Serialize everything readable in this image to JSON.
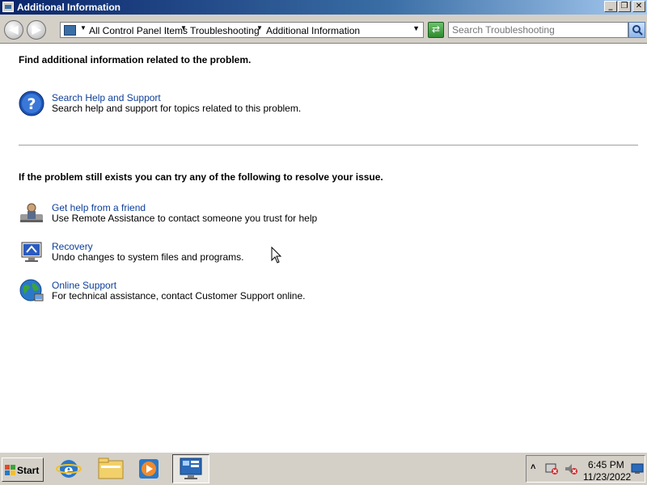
{
  "window": {
    "title": "Additional Information",
    "controls": {
      "minimize": "_",
      "maximize": "❐",
      "close": "✕"
    }
  },
  "toolbar": {
    "breadcrumb": [
      "All Control Panel Items",
      "Troubleshooting",
      "Additional Information"
    ],
    "search_placeholder": "Search Troubleshooting"
  },
  "content": {
    "section1_heading": "Find additional information related to the problem.",
    "section1_items": [
      {
        "icon": "help-icon",
        "title": "Search Help and Support",
        "description": "Search help and support for topics related to this problem."
      }
    ],
    "section2_heading": "If the problem still exists you can try any of the following to resolve your issue.",
    "section2_items": [
      {
        "icon": "remote-assistance-icon",
        "title": "Get help from a friend",
        "description": "Use Remote Assistance to contact someone you trust for help"
      },
      {
        "icon": "recovery-icon",
        "title": "Recovery",
        "description": "Undo changes to system files and programs."
      },
      {
        "icon": "globe-icon",
        "title": "Online Support",
        "description": "For technical assistance, contact Customer Support online."
      }
    ]
  },
  "taskbar": {
    "start_label": "Start",
    "pinned": [
      "internet-explorer-icon",
      "windows-explorer-icon",
      "media-player-icon",
      "control-panel-icon"
    ],
    "clock": {
      "time": "6:45 PM",
      "date": "11/23/2022"
    }
  }
}
